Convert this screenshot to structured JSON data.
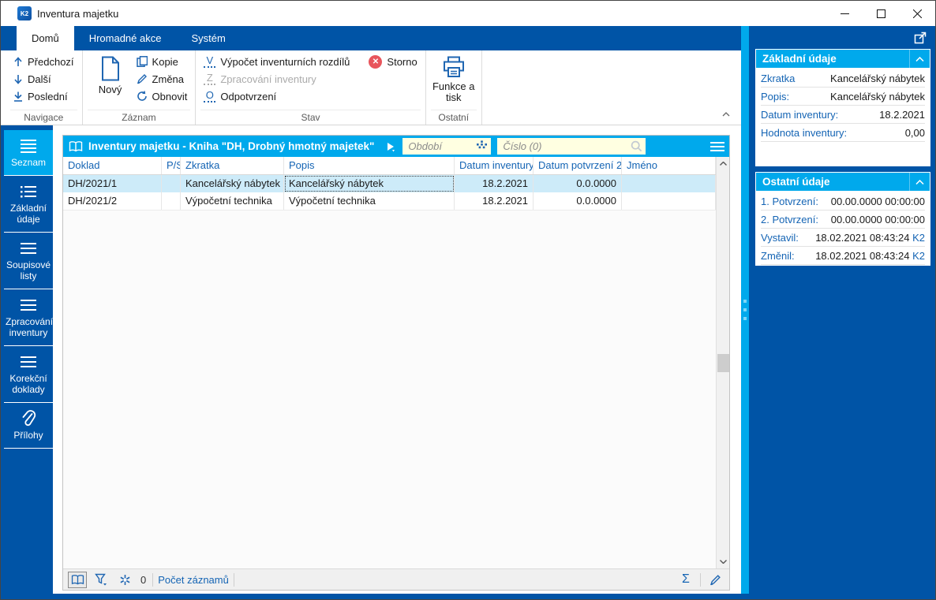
{
  "window": {
    "title": "Inventura majetku",
    "app_badge": "K2"
  },
  "tabs": [
    {
      "label": "Domů",
      "active": true
    },
    {
      "label": "Hromadné akce",
      "active": false
    },
    {
      "label": "Systém",
      "active": false
    }
  ],
  "ribbon": {
    "groups": {
      "navigace": {
        "label": "Navigace",
        "items": [
          "Předchozí",
          "Další",
          "Poslední"
        ]
      },
      "zaznam": {
        "label": "Záznam",
        "novy": "Nový",
        "items": [
          "Kopie",
          "Změna",
          "Obnovit"
        ]
      },
      "stav": {
        "label": "Stav",
        "vypocet": {
          "glyph": "V",
          "label": "Výpočet inventurních rozdílů"
        },
        "storno": {
          "label": "Storno"
        },
        "zpracovani": {
          "glyph": "Z",
          "label": "Zpracování inventury"
        },
        "odpotvrzeni": {
          "glyph": "O",
          "label": "Odpotvrzení"
        }
      },
      "ostatni": {
        "label": "Ostatní",
        "funkce": "Funkce a tisk"
      }
    }
  },
  "sidebar": {
    "items": [
      {
        "label": "Seznam",
        "icon": "list-icon",
        "active": true
      },
      {
        "label": "Základní údaje",
        "icon": "detail-list-icon",
        "active": false
      },
      {
        "label": "Soupisové listy",
        "icon": "list-icon",
        "active": false
      },
      {
        "label": "Zpracování inventury",
        "icon": "list-icon",
        "active": false
      },
      {
        "label": "Korekční doklady",
        "icon": "list-icon",
        "active": false
      },
      {
        "label": "Přílohy",
        "icon": "paperclip-icon",
        "active": false
      }
    ]
  },
  "grid": {
    "title": "Inventury majetku - Kniha \"DH, Drobný hmotný majetek\"",
    "filters": {
      "obdobi": "Období",
      "cislo": "Číslo (0)"
    },
    "columns": [
      "Doklad",
      "P/S",
      "Zkratka",
      "Popis",
      "Datum inventury",
      "Datum potvrzení 2",
      "Jméno"
    ],
    "rows": [
      {
        "cells": [
          "DH/2021/1",
          "",
          "Kancelářský nábytek",
          "Kancelářský nábytek",
          "18.2.2021",
          "0.0.0000",
          ""
        ],
        "selected": true
      },
      {
        "cells": [
          "DH/2021/2",
          "",
          "Výpočetní technika",
          "Výpočetní technika",
          "18.2.2021",
          "0.0.0000",
          ""
        ],
        "selected": false
      }
    ],
    "footer": {
      "count": "0",
      "count_label": "Počet záznamů"
    }
  },
  "panels": [
    {
      "title": "Základní údaje",
      "rows": [
        {
          "label": "Zkratka",
          "value": "Kancelářský nábytek"
        },
        {
          "label": "Popis:",
          "value": "Kancelářský nábytek"
        },
        {
          "label": "Datum inventury:",
          "value": "18.2.2021"
        },
        {
          "label": "Hodnota inventury:",
          "value": "0,00"
        }
      ]
    },
    {
      "title": "Ostatní údaje",
      "rows": [
        {
          "label": "1. Potvrzení:",
          "value": "00.00.0000 00:00:00"
        },
        {
          "label": "2. Potvrzení:",
          "value": "00.00.0000 00:00:00"
        },
        {
          "label": "Vystavil:",
          "value": "18.02.2021 08:43:24",
          "suffix": "K2"
        },
        {
          "label": "Změnil:",
          "value": "18.02.2021 08:43:24",
          "suffix": "K2"
        }
      ]
    }
  ],
  "colors": {
    "dark_blue": "#0054A6",
    "cyan": "#00A9EC",
    "selected_row": "#CDEBF9",
    "label_blue": "#1464B4",
    "field_yellow": "#FFFFE1",
    "storno_red": "#E8555C"
  }
}
